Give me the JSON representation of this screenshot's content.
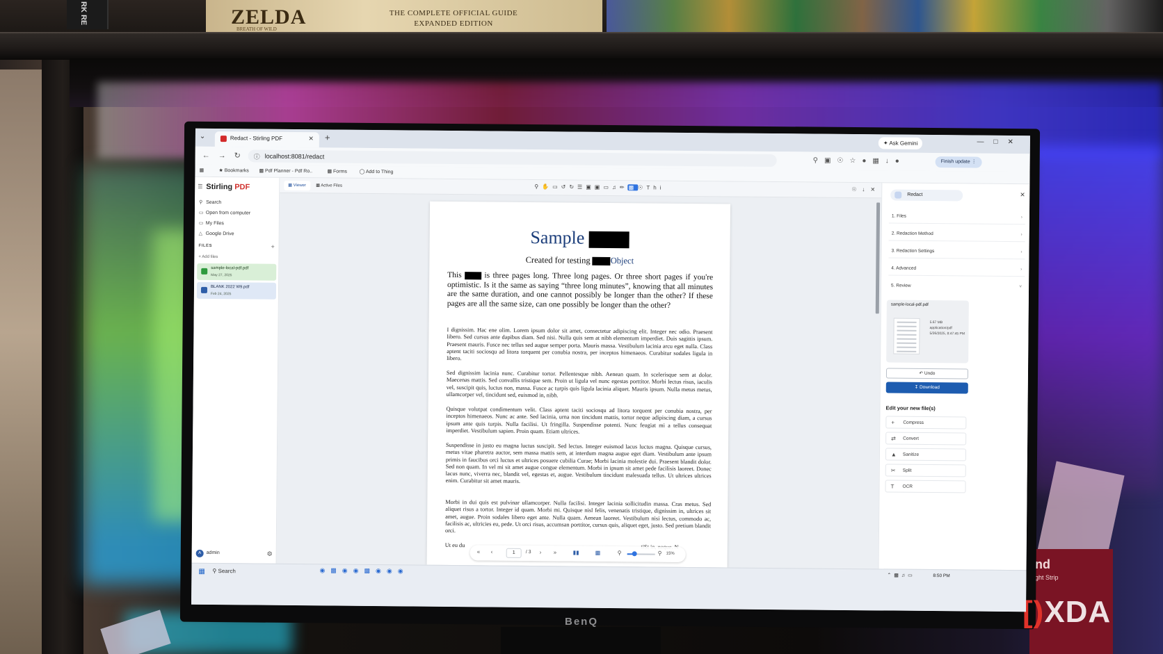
{
  "scene": {
    "shelf_box_lines": [
      "ZELDA",
      "BREATH OF WILD",
      "THE COMPLETE OFFICIAL GUIDE",
      "EXPANDED EDITION"
    ],
    "small_box": "RK RE",
    "monitor_brand": "BenQ",
    "right_box": {
      "title": "nd",
      "sub": "ght Strip"
    },
    "watermark": {
      "mark": "[)",
      "text": "XDA"
    }
  },
  "browser": {
    "tab_title": "Redact - Stirling PDF",
    "ask_gemini": "Ask Gemini",
    "url": "localhost:8081/redact",
    "finish_update": "Finish update",
    "bookmarks": [
      "Bookmarks",
      "Pdf Planner - Pdf Ro..",
      "Forms",
      "Add to Thing"
    ]
  },
  "app": {
    "brand": {
      "name": "Stirling",
      "suffix": "PDF"
    },
    "nav": [
      {
        "label": "Search",
        "icon": "search-icon"
      },
      {
        "label": "Open from computer",
        "icon": "monitor-icon"
      },
      {
        "label": "My Files",
        "icon": "folder-icon"
      },
      {
        "label": "Google Drive",
        "icon": "drive-icon"
      }
    ],
    "files_header": "FILES",
    "add_files": "Add files",
    "files": [
      {
        "name": "sample-local-pdf.pdf",
        "date": "May 27, 2025",
        "selected": true
      },
      {
        "name": "BLANK 2022 W9.pdf",
        "date": "Feb 24, 2025",
        "selected": false
      }
    ],
    "user": "admin"
  },
  "viewer": {
    "tabs": [
      "Viewer",
      "Active Files"
    ],
    "tool_overflow": "Thi",
    "page_input": "1",
    "page_total": "/ 3",
    "zoom": "15%",
    "zoom_level": 0.25
  },
  "document": {
    "title": "Sample",
    "subtitle_pre": "Created for testing",
    "subtitle_post": "Object",
    "intro_pre": "This",
    "intro_post": "is three pages long. Three long pages. Or three short pages if you're optimistic. Is it the same as saying “three long minutes”, knowing that all minutes are the same duration, and one cannot possibly be longer than the other? If these pages are all the same size, can one possibly be longer than the other?",
    "paragraphs": [
      "I dignissim. Hac ene olim. Lorem ipsum dolor sit amet, consectetur adipiscing elit. Integer nec odio. Praesent libero. Sed cursus ante dapibus diam. Sed nisi. Nulla quis sem at nibh elementum imperdiet. Duis sagittis ipsum. Praesent mauris. Fusce nec tellus sed augue semper porta. Mauris massa. Vestibulum lacinia arcu eget nulla. Class aptent taciti sociosqu ad litora torquent per conubia nostra, per inceptos himenaeos. Curabitur sodales ligula in libero.",
      "Sed dignissim lacinia nunc. Curabitur tortor. Pellentesque nibh. Aenean quam. In scelerisque sem at dolor. Maecenas mattis. Sed convallis tristique sem. Proin ut ligula vel nunc egestas porttitor. Morbi lectus risus, iaculis vel, suscipit quis, luctus non, massa. Fusce ac turpis quis ligula lacinia aliquet. Mauris ipsum. Nulla metus metus, ullamcorper vel, tincidunt sed, euismod in, nibh.",
      "Quisque volutpat condimentum velit. Class aptent taciti sociosqu ad litora torquent per conubia nostra, per inceptos himenaeos. Nunc ac ante. Sed lacinia, urna non tincidunt mattis, tortor neque adipiscing diam, a cursus ipsum ante quis turpis. Nulla facilisi. Ut fringilla. Suspendisse potenti. Nunc feugiat mi a tellus consequat imperdiet. Vestibulum sapien. Proin quam. Etiam ultrices.",
      "Suspendisse in justo eu magna luctus suscipit. Sed lectus. Integer euismod lacus luctus magna. Quisque cursus, metus vitae pharetra auctor, sem massa mattis sem, at interdum magna augue eget diam. Vestibulum ante ipsum primis in faucibus orci luctus et ultrices posuere cubilia Curae; Morbi lacinia molestie dui. Praesent blandit dolor. Sed non quam. In vel mi sit amet augue congue elementum. Morbi in ipsum sit amet pede facilisis laoreet. Donec lacus nunc, viverra nec, blandit vel, egestas et, augue. Vestibulum tincidunt malesuada tellus. Ut ultrices ultrices enim. Curabitur sit amet mauris.",
      "Morbi in dui quis est pulvinar ullamcorper. Nulla facilisi. Integer lacinia sollicitudin massa. Cras metus. Sed aliquet risus a tortor. Integer id quam. Morbi mi. Quisque nisl felis, venenatis tristique, dignissim in, ultrices sit amet, augue. Proin sodales libero eget ante. Nulla quam. Aenean laoreet. Vestibulum nisi lectus, commodo ac, facilisis ac, ultricies eu, pede. Ut orci risus, accumsan porttitor, cursus quis, aliquet eget, justo. Sed pretium blandit orci.",
      "Ut eu du                                                                                                                          tiSt in, neque. N                                                                                                                      potent"
    ]
  },
  "panel": {
    "tool": "Redact",
    "steps": [
      {
        "label": "1. Files",
        "chevron": "›"
      },
      {
        "label": "2. Redaction Method",
        "chevron": "›"
      },
      {
        "label": "3. Redaction Settings",
        "chevron": "›"
      },
      {
        "label": "4. Advanced",
        "chevron": "›"
      },
      {
        "label": "5. Review",
        "chevron": "˅"
      }
    ],
    "review": {
      "file": "sample-local-pdf.pdf",
      "size": "5.67 MB",
      "type": "application/pdf",
      "date": "5/26/2025, 8:47:45 PM"
    },
    "undo": "Undo",
    "download": "Download",
    "edit_header": "Edit your new file(s)",
    "ops": [
      {
        "label": "Compress",
        "icon": "plus-icon"
      },
      {
        "label": "Convert",
        "icon": "convert-icon"
      },
      {
        "label": "Sanitize",
        "icon": "sanitize-icon"
      },
      {
        "label": "Split",
        "icon": "split-icon"
      },
      {
        "label": "OCR",
        "icon": "ocr-icon"
      }
    ]
  },
  "taskbar": {
    "search": "Search",
    "time": "8:50 PM"
  }
}
